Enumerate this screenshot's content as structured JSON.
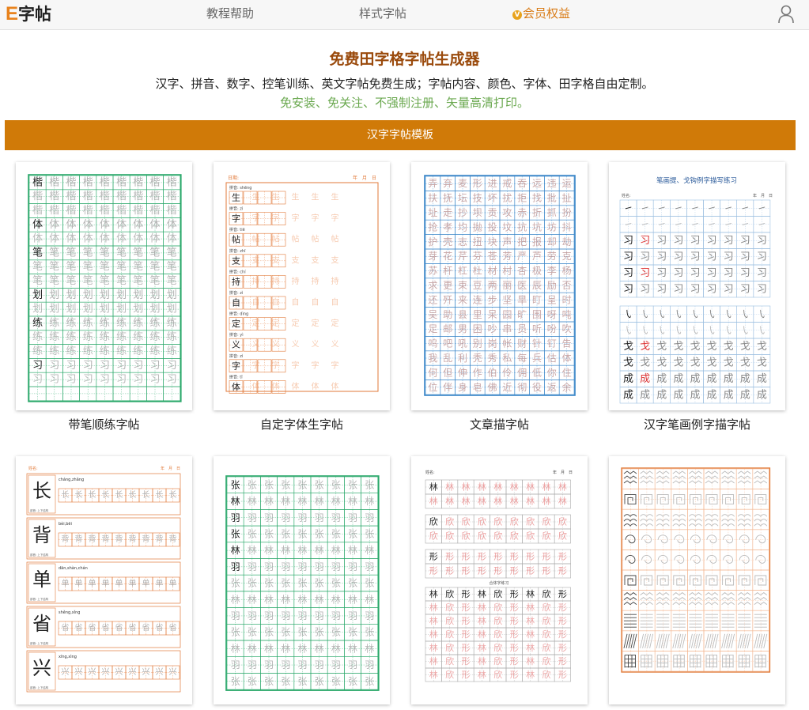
{
  "nav": {
    "logo_e": "E",
    "logo_text": "字帖",
    "tutorial": "教程帮助",
    "styles": "样式字帖",
    "vip_badge": "V",
    "vip": "会员权益",
    "user_icon": "user-icon"
  },
  "hero": {
    "title": "免费田字格字帖生成器",
    "desc": "汉字、拼音、数字、控笔训练、英文字帖免费生成；字帖内容、颜色、字体、田字格自由定制。",
    "sub": "免安装、免关注、不强制注册、矢量高清打印。"
  },
  "section": {
    "title": "汉字字帖模板"
  },
  "colors": {
    "accent": "#d07a08",
    "green": "#2aa86a",
    "orange": "#e27a3a",
    "blue": "#3a86c8"
  },
  "templates": [
    {
      "caption": "带笔顺练字帖",
      "chars": [
        "楷",
        "体",
        "笔",
        "划",
        "练",
        "习"
      ]
    },
    {
      "caption": "自定字体生字帖",
      "chars": [
        "生",
        "字",
        "帖",
        "支",
        "持",
        "自",
        "定",
        "义",
        "字",
        "体"
      ],
      "pinyin": [
        "shēng",
        "zì",
        "tiē",
        "zhī",
        "chí",
        "zì",
        "dìng",
        "yì",
        "zì",
        "tǐ"
      ],
      "header_label": "日期:",
      "header_date": "年　月　日"
    },
    {
      "caption": "文章描字帖",
      "rows": [
        "弄 弃 麦 形 进 戒 吞 远 违 运",
        "扶 抚 坛 技 坏 扰 拒 找 批 扯",
        "址 走 抄 坝 贡 攻 赤 折 抓 扮",
        "抢 孝 均 抛 投 坟 抗 坑 坊 抖",
        "护 壳 志 扭 块 声 把 报 却 劫",
        "芽 花 芹 芬 苍 芳 严 芦 劳 克",
        "苏 杆 杠 杜 材 村 杏 极 李 杨",
        "求 更 束 豆 两 丽 医 辰 励 否",
        "还 歼 来 连 步 坚 旱 盯 呈 时",
        "吴 助 县 里 呆 园 旷 围 呀 吨",
        "足 邮 男 困 吵 串 员 听 吩 吹",
        "呜 吧 吼 别 岗 帐 财 针 钉 告",
        "我 乱 利 秃 秀 私 每 兵 估 体",
        "何 但 伸 作 伯 伶 佣 低 你 住",
        "位 伴 身 皂 佛 近 彻 役 返 余"
      ]
    },
    {
      "caption": "汉字笔画例字描字帖",
      "title": "笔画提、戈钩例字描写练习",
      "name_label": "姓名:",
      "date_label": "年　月　日",
      "example_chars": [
        "习",
        "戈",
        "成"
      ]
    },
    {
      "caption": "",
      "chars": [
        "长",
        "背",
        "单",
        "省",
        "兴"
      ],
      "pinyin": [
        "cháng,zhǎng",
        "bèi,bēi",
        "dān,shàn,chán",
        "shěng,xǐng",
        "xīng,xìng"
      ],
      "header_label": "姓名:",
      "header_date": "年　月　日",
      "row_note": "部首: 上下结构"
    },
    {
      "caption": "",
      "groups": [
        [
          "张",
          "林",
          "羽"
        ],
        [
          "张",
          "林",
          "羽"
        ]
      ],
      "grid_chars": [
        "张",
        "林",
        "羽"
      ]
    },
    {
      "caption": "",
      "header_label": "姓名:",
      "header_date": "年　月　日",
      "chars": [
        "林",
        "欣",
        "形"
      ],
      "combo": "林 欣 形",
      "combo_note": "合体字练习"
    },
    {
      "caption": "",
      "patterns": [
        "wave",
        "meander",
        "arch",
        "loop",
        "spiral",
        "square-spiral",
        "zigzag",
        "lines",
        "diagonal",
        "grid"
      ]
    }
  ]
}
